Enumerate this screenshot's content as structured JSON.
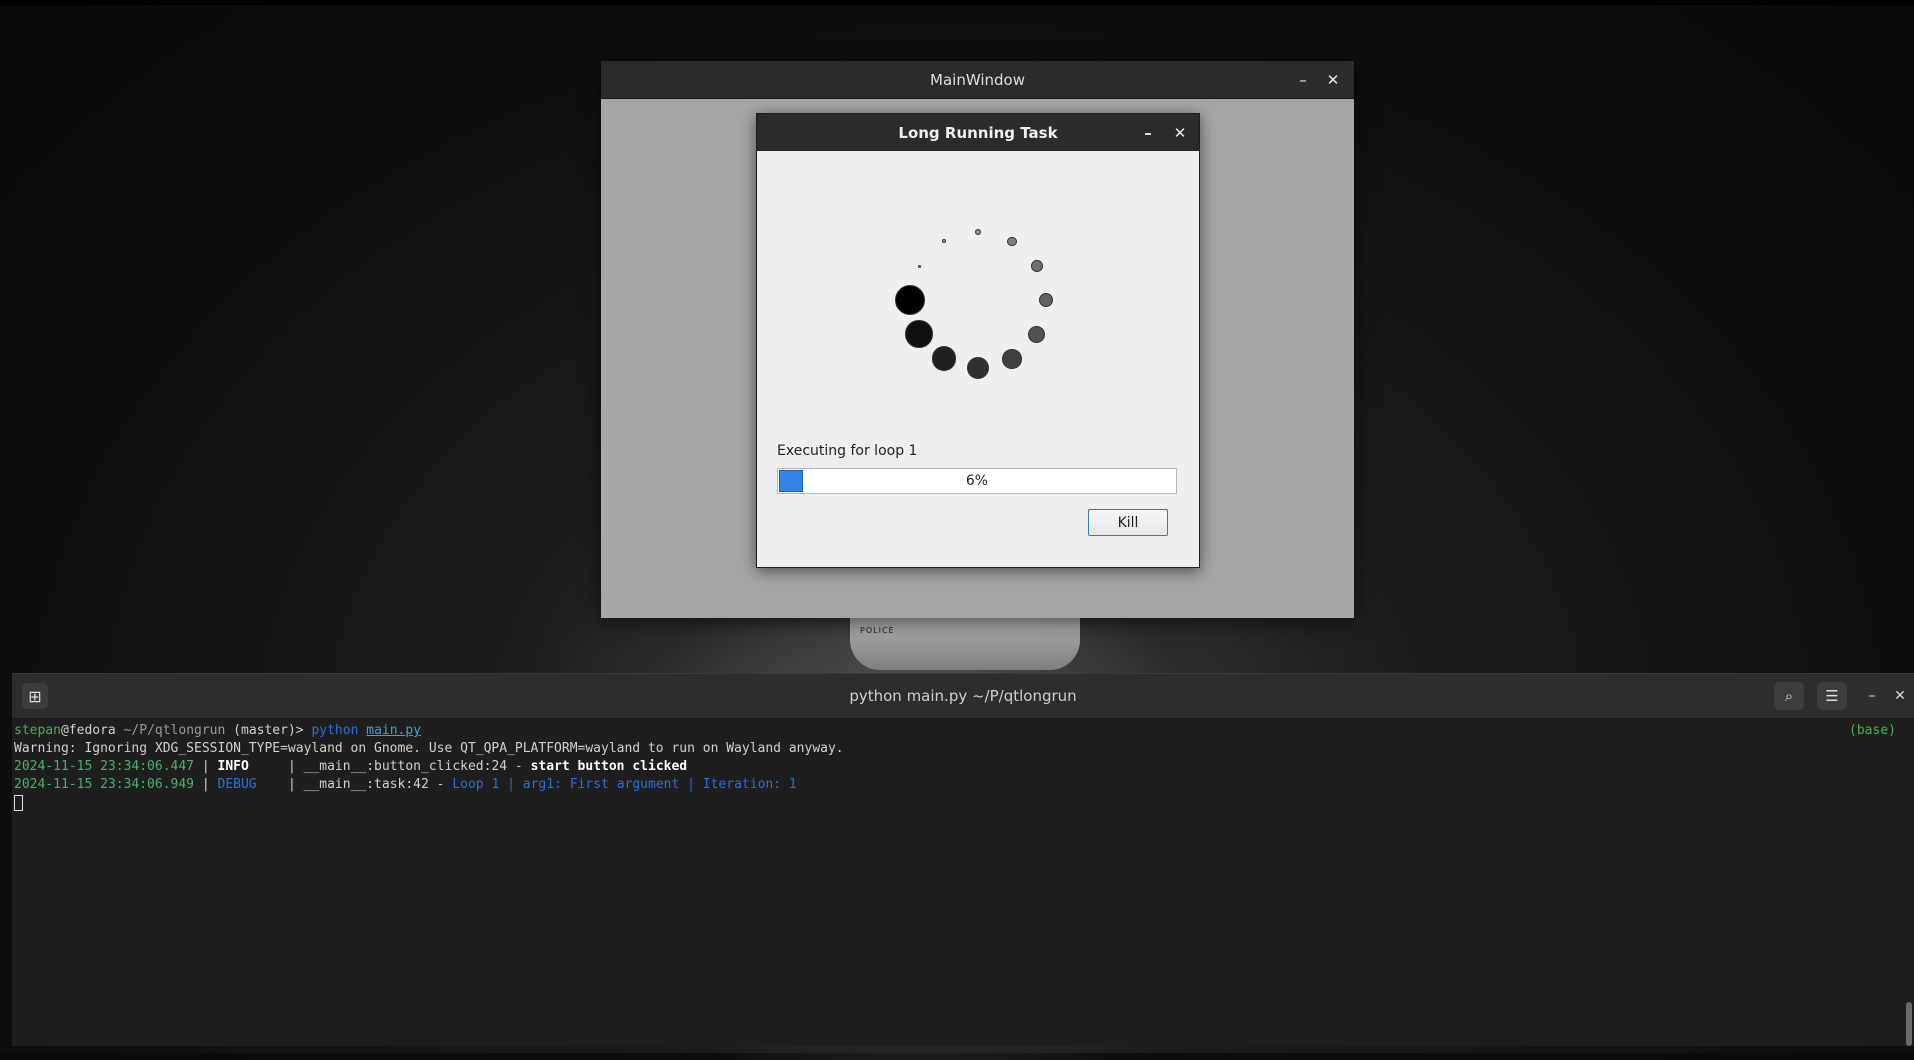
{
  "main_window": {
    "title": "MainWindow",
    "minimize": "–",
    "close": "✕"
  },
  "dialog": {
    "title": "Long Running Task",
    "minimize": "–",
    "close": "✕",
    "status": "Executing for loop 1",
    "progress": {
      "percent": 6,
      "label": "6%"
    },
    "kill_label": "Kill"
  },
  "terminal": {
    "title": "python main.py ~/P/qtlongrun",
    "env": "(base)",
    "prompt": {
      "user": "stepan",
      "at_host": "@fedora",
      "path": "~/P/qtlongrun",
      "branch": "(master)>",
      "cmd": "python",
      "arg": "main.py"
    },
    "warning": "Warning: Ignoring XDG_SESSION_TYPE=wayland on Gnome. Use QT_QPA_PLATFORM=wayland to run on Wayland anyway.",
    "log1": {
      "ts": "2024-11-15 23:34:06.447",
      "sep": " | ",
      "level": "INFO",
      "pad": "     | ",
      "src": "__main__:button_clicked:24",
      "dash": " - ",
      "msg": "start button clicked"
    },
    "log2": {
      "ts": "2024-11-15 23:34:06.949",
      "sep": " | ",
      "level": "DEBUG",
      "pad": "    | ",
      "src": "__main__:task:42",
      "dash": " - ",
      "msg": "Loop 1 | arg1: First argument | Iteration: 1"
    }
  },
  "colors": {
    "progress_fill": "#3584e4",
    "kill_border": "#3a78c3",
    "terminal_bg": "#1e1e1e",
    "prompt_green": "#4caf50"
  }
}
